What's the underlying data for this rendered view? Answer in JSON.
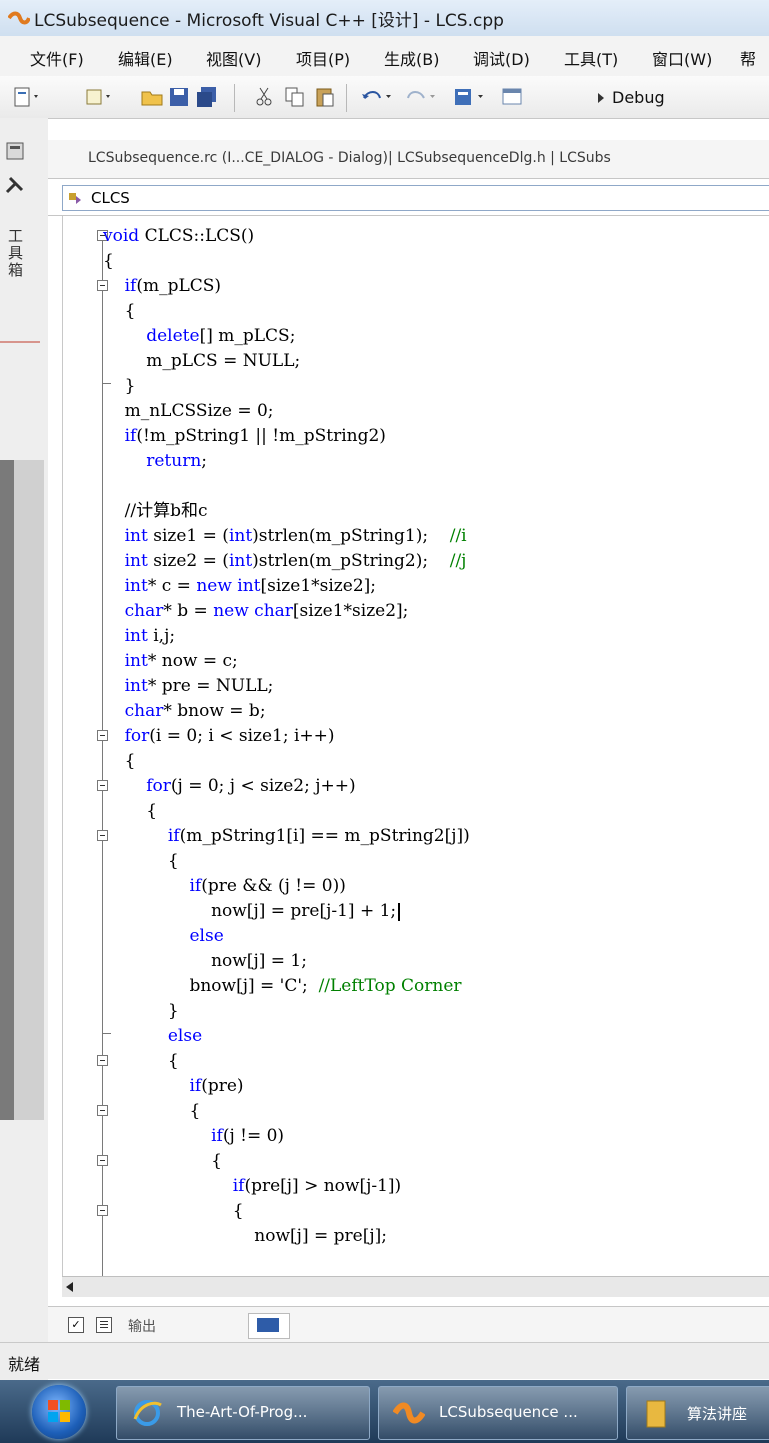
{
  "window": {
    "title": "LCSubsequence - Microsoft Visual C++ [设计] - LCS.cpp"
  },
  "menu": [
    "文件(F)",
    "编辑(E)",
    "视图(V)",
    "项目(P)",
    "生成(B)",
    "调试(D)",
    "工具(T)",
    "窗口(W)",
    "帮"
  ],
  "toolbar": {
    "config": "Debug"
  },
  "toolbox": {
    "label": "工具箱"
  },
  "tabs": {
    "text": "LCSubsequence.rc (I...CE_DIALOG - Dialog)| LCSubsequenceDlg.h | LCSubs"
  },
  "class_selector": {
    "value": "CLCS"
  },
  "code": [
    "void CLCS::LCS()",
    "{",
    "    if(m_pLCS)",
    "    {",
    "        delete[] m_pLCS;",
    "        m_pLCS = NULL;",
    "    }",
    "    m_nLCSSize = 0;",
    "    if(!m_pString1 || !m_pString2)",
    "        return;",
    "",
    "    //计算b和c",
    "    int size1 = (int)strlen(m_pString1);    //i",
    "    int size2 = (int)strlen(m_pString2);    //j",
    "    int* c = new int[size1*size2];",
    "    char* b = new char[size1*size2];",
    "    int i,j;",
    "    int* now = c;",
    "    int* pre = NULL;",
    "    char* bnow = b;",
    "    for(i = 0; i < size1; i++)",
    "    {",
    "        for(j = 0; j < size2; j++)",
    "        {",
    "            if(m_pString1[i] == m_pString2[j])",
    "            {",
    "                if(pre && (j != 0))",
    "                    now[j] = pre[j-1] + 1;",
    "                else",
    "                    now[j] = 1;",
    "                bnow[j] = 'C';  //LeftTop Corner",
    "            }",
    "            else",
    "            {",
    "                if(pre)",
    "                {",
    "                    if(j != 0)",
    "                    {",
    "                        if(pre[j] > now[j-1])",
    "                        {",
    "                            now[j] = pre[j];"
  ],
  "bottom_tabs": {
    "output": "输出"
  },
  "status": {
    "text": "就绪"
  },
  "taskbar": {
    "items": [
      "The-Art-Of-Prog...",
      "LCSubsequence ...",
      "算法讲座"
    ]
  },
  "colors": {
    "keyword": "#0000ff",
    "comment": "#008000"
  }
}
